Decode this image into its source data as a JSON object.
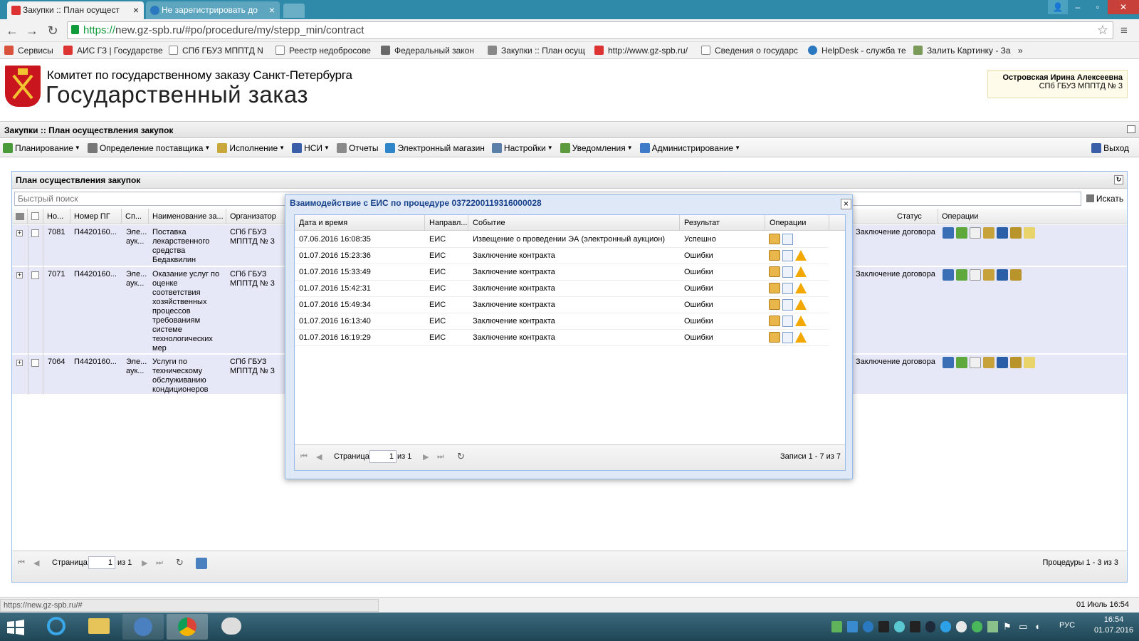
{
  "browser": {
    "tabs": [
      {
        "title": "Закупки :: План осущест"
      },
      {
        "title": "Не зарегистрировать до"
      }
    ],
    "url_scheme": "https://",
    "url_rest": "new.gz-spb.ru/#po/procedure/my/stepp_min/contract",
    "bookmarks": [
      "Сервисы",
      "АИС ГЗ | Государстве",
      "СПб ГБУЗ МППТД N",
      "Реестр недобросове",
      "Федеральный закон",
      "Закупки :: План осущ",
      "http://www.gz-spb.ru/",
      "Сведения о государс",
      "HelpDesk - служба те",
      "Залить Картинку - За"
    ],
    "more": "»"
  },
  "header": {
    "org": "Комитет по государственному заказу Санкт-Петербурга",
    "system": "Государственный заказ",
    "user_name": "Островская Ирина Алексеевна",
    "user_org": "СПб ГБУЗ МППТД № 3"
  },
  "panel_title": "Закупки :: План осуществления закупок",
  "menu": [
    {
      "label": "Планирование",
      "dd": true,
      "color": "#4a9a3c"
    },
    {
      "label": "Определение поставщика",
      "dd": true,
      "color": "#777777"
    },
    {
      "label": "Исполнение",
      "dd": true,
      "color": "#c9a73a"
    },
    {
      "label": "НСИ",
      "dd": true,
      "color": "#3a5fa8"
    },
    {
      "label": "Отчеты",
      "dd": false,
      "color": "#8a8a8a"
    },
    {
      "label": "Электронный магазин",
      "dd": false,
      "color": "#2f86c8"
    },
    {
      "label": "Настройки",
      "dd": true,
      "color": "#5a7fa8"
    },
    {
      "label": "Уведомления",
      "dd": true,
      "color": "#5d9a3d"
    },
    {
      "label": "Администрирование",
      "dd": true,
      "color": "#3d7bc8"
    }
  ],
  "logout": "Выход",
  "grid": {
    "title": "План осуществления закупок",
    "search_placeholder": "Быстрый поиск",
    "search_button": "Искать",
    "columns": [
      "Но...",
      "Номер ПГ",
      "Сп...",
      "Наименование за...",
      "Организатор",
      "Статус",
      "Операции"
    ],
    "rows": [
      {
        "no": "7081",
        "pg": "П4420160...",
        "sp": "Эле... аук...",
        "name": "Поставка лекарственного средства Бедаквилин",
        "org": "СПб ГБУЗ МППТД № 3",
        "status": "Заключение договора"
      },
      {
        "no": "7071",
        "pg": "П4420160...",
        "sp": "Эле... аук...",
        "name": "Оказание услуг по оценке соответствия хозяйственных процессов требованиям системе технологических мер",
        "org": "СПб ГБУЗ МППТД № 3",
        "status": "Заключение договора"
      },
      {
        "no": "7064",
        "pg": "П4420160...",
        "sp": "Эле... аук...",
        "name": "Услуги по техническому обслуживанию кондиционеров",
        "org": "СПб ГБУЗ МППТД № 3",
        "status": "Заключение договора"
      }
    ],
    "page_label": "Страница",
    "page_value": "1",
    "page_of": "из 1",
    "records": "Процедуры 1 - 3 из 3"
  },
  "modal": {
    "title": "Взаимодействие с ЕИС по процедуре 0372200119316000028",
    "columns": [
      "Дата и время",
      "Направл...",
      "Событие",
      "Результат",
      "Операции"
    ],
    "rows": [
      {
        "dt": "07.06.2016 16:08:35",
        "dir": "ЕИС",
        "event": "Извещение о проведении ЭА (электронный аукцион)",
        "result": "Успешно",
        "warn": false
      },
      {
        "dt": "01.07.2016 15:23:36",
        "dir": "ЕИС",
        "event": "Заключение контракта",
        "result": "Ошибки",
        "warn": true
      },
      {
        "dt": "01.07.2016 15:33:49",
        "dir": "ЕИС",
        "event": "Заключение контракта",
        "result": "Ошибки",
        "warn": true
      },
      {
        "dt": "01.07.2016 15:42:31",
        "dir": "ЕИС",
        "event": "Заключение контракта",
        "result": "Ошибки",
        "warn": true
      },
      {
        "dt": "01.07.2016 15:49:34",
        "dir": "ЕИС",
        "event": "Заключение контракта",
        "result": "Ошибки",
        "warn": true
      },
      {
        "dt": "01.07.2016 16:13:40",
        "dir": "ЕИС",
        "event": "Заключение контракта",
        "result": "Ошибки",
        "warn": true
      },
      {
        "dt": "01.07.2016 16:19:29",
        "dir": "ЕИС",
        "event": "Заключение контракта",
        "result": "Ошибки",
        "warn": true
      }
    ],
    "page_label": "Страница",
    "page_value": "1",
    "page_of": "из 1",
    "records": "Записи 1 - 7 из 7"
  },
  "status": {
    "url": "https://new.gz-spb.ru/#",
    "date": "01 Июль 16:54"
  },
  "taskbar": {
    "lang": "РУС",
    "time": "16:54",
    "date": "01.07.2016"
  }
}
